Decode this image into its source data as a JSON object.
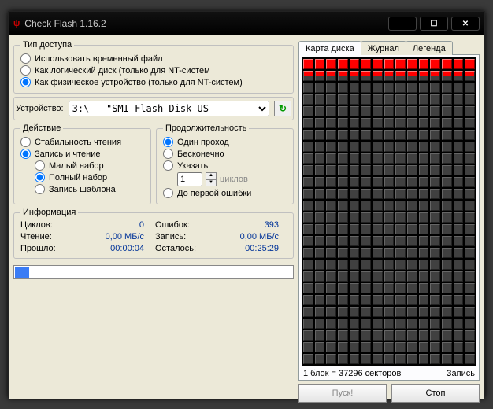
{
  "window": {
    "title": "Check Flash 1.16.2"
  },
  "access": {
    "legend": "Тип доступа",
    "options": [
      "Использовать временный файл",
      "Как логический диск (только для NT-систем",
      "Как физическое устройство (только для NT-систем)"
    ],
    "selected": 2
  },
  "device": {
    "label": "Устройство:",
    "value": "3:\\ - \"SMI Flash Disk US"
  },
  "action": {
    "legend": "Действие",
    "options": [
      "Стабильность чтения",
      "Запись и чтение"
    ],
    "selected": 1,
    "sub": [
      "Малый набор",
      "Полный набор",
      "Запись шаблона"
    ],
    "sub_selected": 1
  },
  "duration": {
    "legend": "Продолжительность",
    "options": [
      "Один проход",
      "Бесконечно",
      "Указать",
      "До первой ошибки"
    ],
    "selected": 0,
    "cycles_value": "1",
    "cycles_unit": "циклов"
  },
  "info": {
    "legend": "Информация",
    "cycles_label": "Циклов:",
    "cycles_value": "0",
    "errors_label": "Ошибок:",
    "errors_value": "393",
    "read_label": "Чтение:",
    "read_value": "0,00 МБ/с",
    "write_label": "Запись:",
    "write_value": "0,00 МБ/с",
    "elapsed_label": "Прошло:",
    "elapsed_value": "00:00:04",
    "remaining_label": "Осталось:",
    "remaining_value": "00:25:29"
  },
  "tabs": [
    "Карта диска",
    "Журнал",
    "Легенда"
  ],
  "diskmap": {
    "cols": 15,
    "rows": 26,
    "red_cells": 15,
    "halfred_cells": 15
  },
  "status": {
    "block_info": "1 блок = 37296 секторов",
    "mode": "Запись"
  },
  "buttons": {
    "start": "Пуск!",
    "stop": "Стоп"
  },
  "progress_percent": 5
}
